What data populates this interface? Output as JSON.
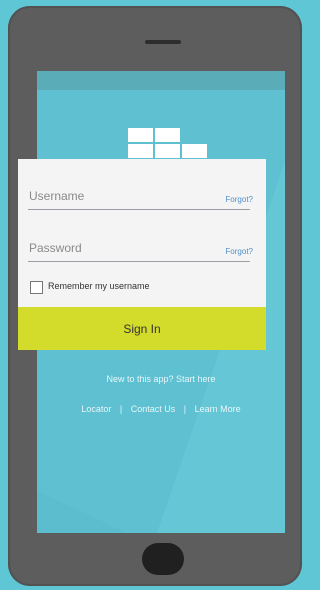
{
  "login": {
    "username_placeholder": "Username",
    "password_placeholder": "Password",
    "forgot_username_label": "Forgot?",
    "forgot_password_label": "Forgot?",
    "remember_label": "Remember my username",
    "remember_checked": false,
    "signin_label": "Sign In"
  },
  "footer": {
    "new_app_text": "New to this app? Start here",
    "links": [
      "Locator",
      "Contact Us",
      "Learn More"
    ],
    "separator": "|"
  },
  "colors": {
    "background": "#5fc6d6",
    "phone_body": "#5d5d5d",
    "screen": "#5ec0d1",
    "signin_button": "#d4dc2b",
    "forgot_link": "#4f8fc9"
  },
  "icons": {
    "logo": "brick-blocks-logo",
    "speaker": "speaker-grille",
    "home": "home-button"
  }
}
